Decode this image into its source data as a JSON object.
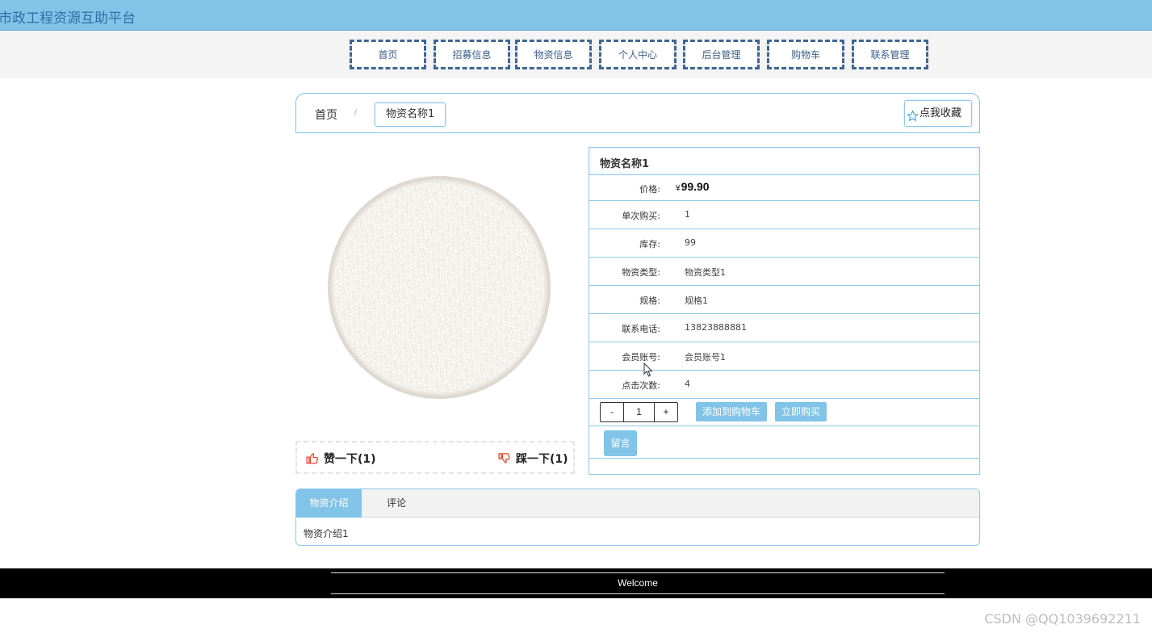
{
  "site_title": "市政工程资源互助平台",
  "nav": [
    {
      "label": "首页"
    },
    {
      "label": "招募信息"
    },
    {
      "label": "物资信息"
    },
    {
      "label": "个人中心"
    },
    {
      "label": "后台管理"
    },
    {
      "label": "购物车"
    },
    {
      "label": "联系管理"
    }
  ],
  "breadcrumb": {
    "home": "首页",
    "separator": "/",
    "current": "物资名称1"
  },
  "favorite_label": "点我收藏",
  "product": {
    "name": "物资名称1",
    "price_label": "价格:",
    "currency": "¥",
    "price": "99.90",
    "fields": [
      {
        "label": "单次购买:",
        "value": "1"
      },
      {
        "label": "库存:",
        "value": "99"
      },
      {
        "label": "物资类型:",
        "value": "物资类型1"
      },
      {
        "label": "规格:",
        "value": "规格1"
      },
      {
        "label": "联系电话:",
        "value": "13823888881"
      },
      {
        "label": "会员账号:",
        "value": "会员账号1"
      },
      {
        "label": "点击次数:",
        "value": "4"
      }
    ],
    "quantity": {
      "minus": "-",
      "value": "1",
      "plus": "+"
    },
    "add_to_cart": "添加到购物车",
    "buy_now": "立即购买",
    "message": "留言"
  },
  "likes": {
    "like": "赞一下(1)",
    "dislike": "踩一下(1)"
  },
  "tabs": [
    {
      "label": "物资介绍"
    },
    {
      "label": "评论"
    }
  ],
  "tab_content": "物资介绍1",
  "footer": {
    "welcome": "Welcome"
  },
  "watermark": "CSDN @QQ1039692211",
  "colors": {
    "accent": "#82c3e8",
    "nav_border": "#3f6593",
    "footer_bg": "#000000"
  }
}
